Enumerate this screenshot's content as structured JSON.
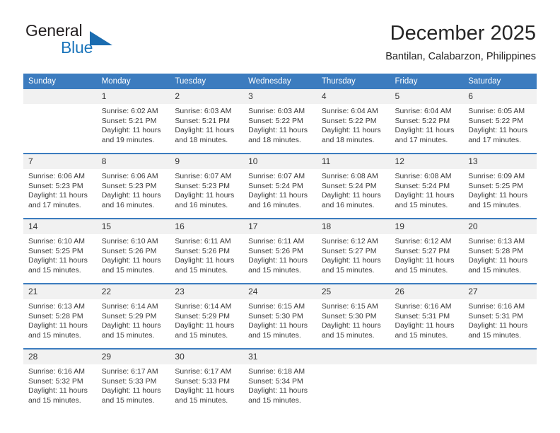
{
  "brand": {
    "name_part1": "General",
    "name_part2": "Blue",
    "triangle_color": "#1b6cb0",
    "blue_color": "#1b75bb"
  },
  "header": {
    "title": "December 2025",
    "subtitle": "Bantilan, Calabarzon, Philippines"
  },
  "theme": {
    "header_bar_color": "#3c7cbf",
    "daynum_bg": "#f1f1f1",
    "row_divider": "#3c7cbf"
  },
  "weekdays": [
    "Sunday",
    "Monday",
    "Tuesday",
    "Wednesday",
    "Thursday",
    "Friday",
    "Saturday"
  ],
  "weeks": [
    [
      {
        "day": "",
        "blank": true,
        "sunrise": "",
        "sunset": "",
        "daylight_line1": "",
        "daylight_line2": ""
      },
      {
        "day": "1",
        "sunrise": "Sunrise: 6:02 AM",
        "sunset": "Sunset: 5:21 PM",
        "daylight_line1": "Daylight: 11 hours",
        "daylight_line2": "and 19 minutes."
      },
      {
        "day": "2",
        "sunrise": "Sunrise: 6:03 AM",
        "sunset": "Sunset: 5:21 PM",
        "daylight_line1": "Daylight: 11 hours",
        "daylight_line2": "and 18 minutes."
      },
      {
        "day": "3",
        "sunrise": "Sunrise: 6:03 AM",
        "sunset": "Sunset: 5:22 PM",
        "daylight_line1": "Daylight: 11 hours",
        "daylight_line2": "and 18 minutes."
      },
      {
        "day": "4",
        "sunrise": "Sunrise: 6:04 AM",
        "sunset": "Sunset: 5:22 PM",
        "daylight_line1": "Daylight: 11 hours",
        "daylight_line2": "and 18 minutes."
      },
      {
        "day": "5",
        "sunrise": "Sunrise: 6:04 AM",
        "sunset": "Sunset: 5:22 PM",
        "daylight_line1": "Daylight: 11 hours",
        "daylight_line2": "and 17 minutes."
      },
      {
        "day": "6",
        "sunrise": "Sunrise: 6:05 AM",
        "sunset": "Sunset: 5:22 PM",
        "daylight_line1": "Daylight: 11 hours",
        "daylight_line2": "and 17 minutes."
      }
    ],
    [
      {
        "day": "7",
        "sunrise": "Sunrise: 6:06 AM",
        "sunset": "Sunset: 5:23 PM",
        "daylight_line1": "Daylight: 11 hours",
        "daylight_line2": "and 17 minutes."
      },
      {
        "day": "8",
        "sunrise": "Sunrise: 6:06 AM",
        "sunset": "Sunset: 5:23 PM",
        "daylight_line1": "Daylight: 11 hours",
        "daylight_line2": "and 16 minutes."
      },
      {
        "day": "9",
        "sunrise": "Sunrise: 6:07 AM",
        "sunset": "Sunset: 5:23 PM",
        "daylight_line1": "Daylight: 11 hours",
        "daylight_line2": "and 16 minutes."
      },
      {
        "day": "10",
        "sunrise": "Sunrise: 6:07 AM",
        "sunset": "Sunset: 5:24 PM",
        "daylight_line1": "Daylight: 11 hours",
        "daylight_line2": "and 16 minutes."
      },
      {
        "day": "11",
        "sunrise": "Sunrise: 6:08 AM",
        "sunset": "Sunset: 5:24 PM",
        "daylight_line1": "Daylight: 11 hours",
        "daylight_line2": "and 16 minutes."
      },
      {
        "day": "12",
        "sunrise": "Sunrise: 6:08 AM",
        "sunset": "Sunset: 5:24 PM",
        "daylight_line1": "Daylight: 11 hours",
        "daylight_line2": "and 15 minutes."
      },
      {
        "day": "13",
        "sunrise": "Sunrise: 6:09 AM",
        "sunset": "Sunset: 5:25 PM",
        "daylight_line1": "Daylight: 11 hours",
        "daylight_line2": "and 15 minutes."
      }
    ],
    [
      {
        "day": "14",
        "sunrise": "Sunrise: 6:10 AM",
        "sunset": "Sunset: 5:25 PM",
        "daylight_line1": "Daylight: 11 hours",
        "daylight_line2": "and 15 minutes."
      },
      {
        "day": "15",
        "sunrise": "Sunrise: 6:10 AM",
        "sunset": "Sunset: 5:26 PM",
        "daylight_line1": "Daylight: 11 hours",
        "daylight_line2": "and 15 minutes."
      },
      {
        "day": "16",
        "sunrise": "Sunrise: 6:11 AM",
        "sunset": "Sunset: 5:26 PM",
        "daylight_line1": "Daylight: 11 hours",
        "daylight_line2": "and 15 minutes."
      },
      {
        "day": "17",
        "sunrise": "Sunrise: 6:11 AM",
        "sunset": "Sunset: 5:26 PM",
        "daylight_line1": "Daylight: 11 hours",
        "daylight_line2": "and 15 minutes."
      },
      {
        "day": "18",
        "sunrise": "Sunrise: 6:12 AM",
        "sunset": "Sunset: 5:27 PM",
        "daylight_line1": "Daylight: 11 hours",
        "daylight_line2": "and 15 minutes."
      },
      {
        "day": "19",
        "sunrise": "Sunrise: 6:12 AM",
        "sunset": "Sunset: 5:27 PM",
        "daylight_line1": "Daylight: 11 hours",
        "daylight_line2": "and 15 minutes."
      },
      {
        "day": "20",
        "sunrise": "Sunrise: 6:13 AM",
        "sunset": "Sunset: 5:28 PM",
        "daylight_line1": "Daylight: 11 hours",
        "daylight_line2": "and 15 minutes."
      }
    ],
    [
      {
        "day": "21",
        "sunrise": "Sunrise: 6:13 AM",
        "sunset": "Sunset: 5:28 PM",
        "daylight_line1": "Daylight: 11 hours",
        "daylight_line2": "and 15 minutes."
      },
      {
        "day": "22",
        "sunrise": "Sunrise: 6:14 AM",
        "sunset": "Sunset: 5:29 PM",
        "daylight_line1": "Daylight: 11 hours",
        "daylight_line2": "and 15 minutes."
      },
      {
        "day": "23",
        "sunrise": "Sunrise: 6:14 AM",
        "sunset": "Sunset: 5:29 PM",
        "daylight_line1": "Daylight: 11 hours",
        "daylight_line2": "and 15 minutes."
      },
      {
        "day": "24",
        "sunrise": "Sunrise: 6:15 AM",
        "sunset": "Sunset: 5:30 PM",
        "daylight_line1": "Daylight: 11 hours",
        "daylight_line2": "and 15 minutes."
      },
      {
        "day": "25",
        "sunrise": "Sunrise: 6:15 AM",
        "sunset": "Sunset: 5:30 PM",
        "daylight_line1": "Daylight: 11 hours",
        "daylight_line2": "and 15 minutes."
      },
      {
        "day": "26",
        "sunrise": "Sunrise: 6:16 AM",
        "sunset": "Sunset: 5:31 PM",
        "daylight_line1": "Daylight: 11 hours",
        "daylight_line2": "and 15 minutes."
      },
      {
        "day": "27",
        "sunrise": "Sunrise: 6:16 AM",
        "sunset": "Sunset: 5:31 PM",
        "daylight_line1": "Daylight: 11 hours",
        "daylight_line2": "and 15 minutes."
      }
    ],
    [
      {
        "day": "28",
        "sunrise": "Sunrise: 6:16 AM",
        "sunset": "Sunset: 5:32 PM",
        "daylight_line1": "Daylight: 11 hours",
        "daylight_line2": "and 15 minutes."
      },
      {
        "day": "29",
        "sunrise": "Sunrise: 6:17 AM",
        "sunset": "Sunset: 5:33 PM",
        "daylight_line1": "Daylight: 11 hours",
        "daylight_line2": "and 15 minutes."
      },
      {
        "day": "30",
        "sunrise": "Sunrise: 6:17 AM",
        "sunset": "Sunset: 5:33 PM",
        "daylight_line1": "Daylight: 11 hours",
        "daylight_line2": "and 15 minutes."
      },
      {
        "day": "31",
        "sunrise": "Sunrise: 6:18 AM",
        "sunset": "Sunset: 5:34 PM",
        "daylight_line1": "Daylight: 11 hours",
        "daylight_line2": "and 15 minutes."
      },
      {
        "day": "",
        "blank": true,
        "sunrise": "",
        "sunset": "",
        "daylight_line1": "",
        "daylight_line2": ""
      },
      {
        "day": "",
        "blank": true,
        "sunrise": "",
        "sunset": "",
        "daylight_line1": "",
        "daylight_line2": ""
      },
      {
        "day": "",
        "blank": true,
        "sunrise": "",
        "sunset": "",
        "daylight_line1": "",
        "daylight_line2": ""
      }
    ]
  ]
}
